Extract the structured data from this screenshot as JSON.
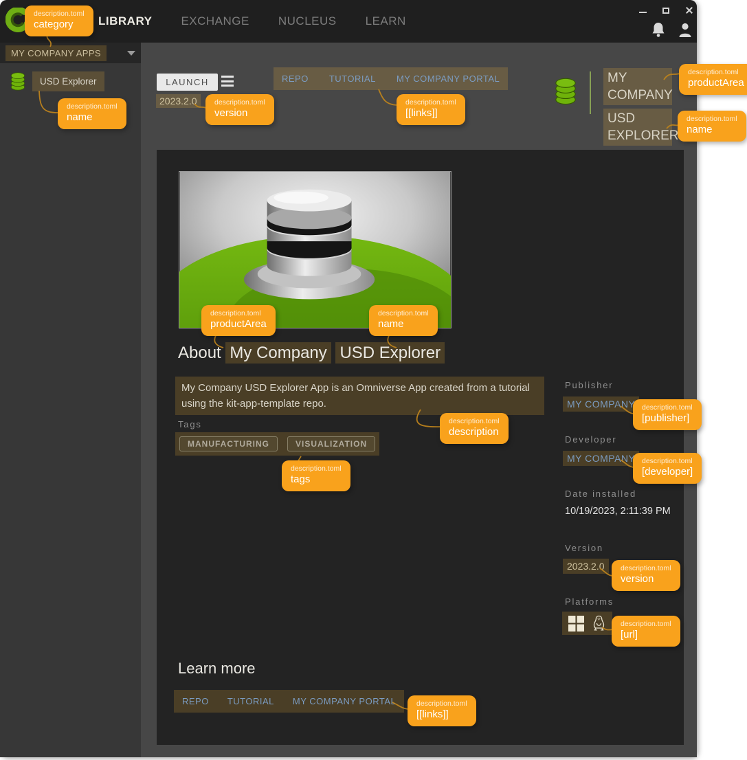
{
  "window": {
    "title_nav": [
      {
        "label": "LIBRARY",
        "active": true
      },
      {
        "label": "EXCHANGE",
        "active": false
      },
      {
        "label": "NUCLEUS",
        "active": false
      },
      {
        "label": "LEARN",
        "active": false
      }
    ]
  },
  "sidebar": {
    "collection_label": "MY COMPANY APPS",
    "items": [
      {
        "label": "USD Explorer"
      }
    ]
  },
  "app_header": {
    "launch_button": "LAUNCH",
    "version": "2023.2.0",
    "links": [
      {
        "label": "REPO"
      },
      {
        "label": "TUTORIAL"
      },
      {
        "label": "MY COMPANY PORTAL"
      }
    ],
    "product_area": "MY COMPANY",
    "product_name": "USD EXPLORER"
  },
  "about": {
    "heading_prefix": "About",
    "heading_product_area": "My Company",
    "heading_name": "USD Explorer",
    "description": "My Company USD Explorer App is an Omniverse App created from a tutorial using the kit-app-template repo.",
    "tags_label": "Tags",
    "tags": [
      {
        "label": "MANUFACTURING"
      },
      {
        "label": "VISUALIZATION"
      }
    ]
  },
  "details": {
    "publisher_label": "Publisher",
    "publisher": "MY COMPANY",
    "developer_label": "Developer",
    "developer": "MY COMPANY",
    "date_installed_label": "Date installed",
    "date_installed": "10/19/2023, 2:11:39 PM",
    "version_label": "Version",
    "version": "2023.2.0",
    "platforms_label": "Platforms"
  },
  "learn_more": {
    "heading": "Learn more",
    "links": [
      {
        "label": "REPO"
      },
      {
        "label": "TUTORIAL"
      },
      {
        "label": "MY COMPANY PORTAL"
      }
    ]
  },
  "annotations": {
    "file_label": "description.toml",
    "callouts": [
      {
        "field": "category"
      },
      {
        "field": "name"
      },
      {
        "field": "version"
      },
      {
        "field": "[[links]]"
      },
      {
        "field": "productArea"
      },
      {
        "field": "name"
      },
      {
        "field": "productArea"
      },
      {
        "field": "name"
      },
      {
        "field": "description"
      },
      {
        "field": "tags"
      },
      {
        "field": "[publisher]"
      },
      {
        "field": "[developer]"
      },
      {
        "field": "version"
      },
      {
        "field": "[url]"
      },
      {
        "field": "[[links]]"
      }
    ]
  },
  "colors": {
    "accent_orange": "#f9a21c",
    "nvidia_green": "#76b900",
    "link_blue": "#7b9cc2"
  }
}
